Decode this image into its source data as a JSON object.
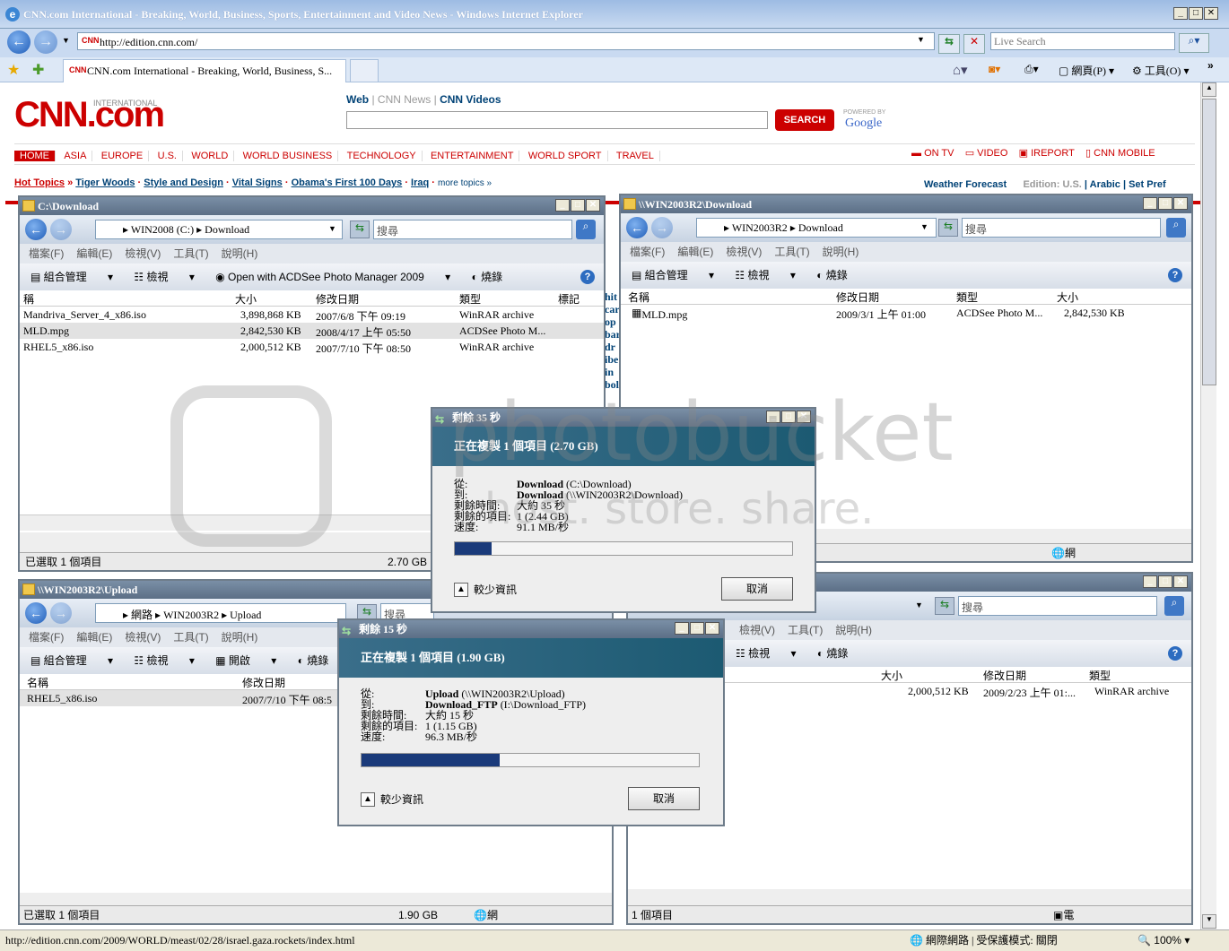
{
  "ie": {
    "title": "CNN.com International - Breaking, World, Business, Sports, Entertainment and Video News - Windows Internet Explorer",
    "url": "http://edition.cnn.com/",
    "search_placeholder": "Live Search",
    "tab_title": "CNN.com International - Breaking, World, Business, S...",
    "cmd_page": "網頁(P)",
    "cmd_tools": "工具(O)",
    "status_url": "http://edition.cnn.com/2009/WORLD/meast/02/28/israel.gaza.rockets/index.html",
    "status_zone": "網際網路 | 受保護模式: 關閉",
    "zoom": "100%"
  },
  "cnn": {
    "logo": "CNN.com",
    "logo_sub": "INTERNATIONAL",
    "search_tabs": [
      "Web",
      "CNN News",
      "CNN Videos"
    ],
    "search_btn": "SEARCH",
    "powered": "POWERED BY",
    "google": "Google",
    "nav": [
      "HOME",
      "ASIA",
      "EUROPE",
      "U.S.",
      "WORLD",
      "WORLD BUSINESS",
      "TECHNOLOGY",
      "ENTERTAINMENT",
      "WORLD SPORT",
      "TRAVEL"
    ],
    "nav_right": [
      "ON TV",
      "VIDEO",
      "IREPORT",
      "CNN MOBILE"
    ],
    "hot_label": "Hot Topics",
    "hot": [
      "Tiger Woods",
      "Style and Design",
      "Vital Signs",
      "Obama's First 100 Days",
      "Iraq"
    ],
    "more": "more topics »",
    "weather": "Weather Forecast",
    "edition": "Edition: U.S.",
    "arabic": "Arabic",
    "setpref": "Set Pref"
  },
  "win1": {
    "title": "C:\\Download",
    "path": [
      "WIN2008 (C:)",
      "Download"
    ],
    "search": "搜尋",
    "menu": [
      "檔案(F)",
      "編輯(E)",
      "檢視(V)",
      "工具(T)",
      "說明(H)"
    ],
    "tools": [
      "組合管理",
      "檢視",
      "Open with ACDSee Photo Manager 2009",
      "燒錄"
    ],
    "cols": [
      "稱",
      "大小",
      "修改日期",
      "類型",
      "標記"
    ],
    "rows": [
      {
        "name": "Mandriva_Server_4_x86.iso",
        "size": "3,898,868 KB",
        "date": "2007/6/8 下午 09:19",
        "type": "WinRAR archive"
      },
      {
        "name": "MLD.mpg",
        "size": "2,842,530 KB",
        "date": "2008/4/17 上午 05:50",
        "type": "ACDSee Photo M..."
      },
      {
        "name": "RHEL5_x86.iso",
        "size": "2,000,512 KB",
        "date": "2007/7/10 下午 08:50",
        "type": "WinRAR archive"
      }
    ],
    "status": "已選取 1 個項目",
    "status_size": "2.70 GB"
  },
  "win2": {
    "title": "\\\\WIN2003R2\\Download",
    "path": [
      "WIN2003R2",
      "Download"
    ],
    "search": "搜尋",
    "menu": [
      "檔案(F)",
      "編輯(E)",
      "檢視(V)",
      "工具(T)",
      "說明(H)"
    ],
    "tools": [
      "組合管理",
      "檢視",
      "燒錄"
    ],
    "cols": [
      "名稱",
      "修改日期",
      "類型",
      "大小"
    ],
    "rows": [
      {
        "name": "MLD.mpg",
        "date": "2009/3/1 上午 01:00",
        "type": "ACDSee Photo M...",
        "size": "2,842,530 KB"
      }
    ],
    "status_zone": "網際網路"
  },
  "win3": {
    "title": "\\\\WIN2003R2\\Upload",
    "path": [
      "網路",
      "WIN2003R2",
      "Upload"
    ],
    "search": "搜尋",
    "menu": [
      "檔案(F)",
      "編輯(E)",
      "檢視(V)",
      "工具(T)",
      "說明(H)"
    ],
    "tools": [
      "組合管理",
      "檢視",
      "開啟",
      "燒錄"
    ],
    "cols": [
      "名稱",
      "修改日期"
    ],
    "rows": [
      {
        "name": "RHEL5_x86.iso",
        "date": "2007/7/10 下午 08:5"
      }
    ],
    "status": "已選取 1 個項目",
    "status_size": "1.90 GB",
    "status_zone": "網際網路"
  },
  "win4": {
    "search": "搜尋",
    "menu": [
      "檢視(V)",
      "工具(T)",
      "說明(H)"
    ],
    "tools": [
      "檢視",
      "燒錄"
    ],
    "cols": [
      "大小",
      "修改日期",
      "類型"
    ],
    "rows": [
      {
        "size": "2,000,512 KB",
        "date": "2009/2/23 上午 01:...",
        "type": "WinRAR archive"
      }
    ],
    "status": "1 個項目",
    "status_zone": "電腦"
  },
  "dlg1": {
    "title": "剩餘 35 秒",
    "banner": "正在複製 1 個項目 (2.70 GB)",
    "labels": [
      "從:",
      "到:",
      "剩餘時間:",
      "剩餘的項目:",
      "速度:"
    ],
    "from": "Download",
    "from_path": "(C:\\Download)",
    "to": "Download",
    "to_path": "(\\\\WIN2003R2\\Download)",
    "time": "大約 35 秒",
    "items": "1 (2.44 GB)",
    "speed": "91.1 MB/秒",
    "progress": 0.11,
    "less": "較少資訊",
    "cancel": "取消"
  },
  "dlg2": {
    "title": "剩餘 15 秒",
    "banner": "正在複製 1 個項目 (1.90 GB)",
    "labels": [
      "從:",
      "到:",
      "剩餘時間:",
      "剩餘的項目:",
      "速度:"
    ],
    "from": "Upload",
    "from_path": "(\\\\WIN2003R2\\Upload)",
    "to": "Download_FTP",
    "to_path": "(I:\\Download_FTP)",
    "time": "大約 15 秒",
    "items": "1 (1.15 GB)",
    "speed": "96.3 MB/秒",
    "progress": 0.41,
    "less": "較少資訊",
    "cancel": "取消"
  },
  "watermark": "photobucket",
  "watermark_sub": "host. store. share."
}
